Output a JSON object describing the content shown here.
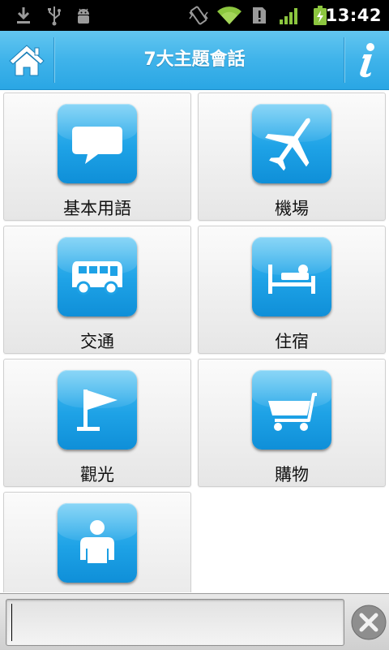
{
  "status_bar": {
    "time": "13:42",
    "icons": [
      "download-icon",
      "usb-icon",
      "android-debug-icon",
      "vibrate-icon",
      "wifi-icon",
      "sim-alert-icon",
      "signal-icon",
      "battery-charging-icon"
    ],
    "accent": "#8cc63f"
  },
  "header": {
    "title": "7大主題會話",
    "home_icon": "home-icon",
    "info_icon": "info-icon",
    "color": "#3fb3ea"
  },
  "topics": [
    {
      "label": "基本用語",
      "icon": "speech-bubble-icon"
    },
    {
      "label": "機場",
      "icon": "airplane-icon"
    },
    {
      "label": "交通",
      "icon": "bus-icon"
    },
    {
      "label": "住宿",
      "icon": "bed-icon"
    },
    {
      "label": "觀光",
      "icon": "flag-icon"
    },
    {
      "label": "購物",
      "icon": "shopping-cart-icon"
    },
    {
      "label": "",
      "icon": "person-icon"
    }
  ],
  "input": {
    "value": "",
    "clear_icon": "close-icon"
  }
}
